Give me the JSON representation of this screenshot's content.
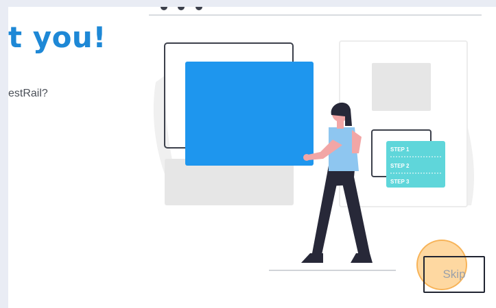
{
  "header": {
    "title": "t you!",
    "question": "estRail?"
  },
  "illustration": {
    "step_labels": [
      "STEP 1",
      "STEP 2",
      "STEP 3"
    ],
    "colors": {
      "accent_blue": "#1e96ee",
      "teal_card": "#5fd6da",
      "shirt": "#8ec6f0",
      "pants": "#272838",
      "skin": "#f2a6a6",
      "hair": "#272838"
    }
  },
  "actions": {
    "skip_label": "Skip"
  },
  "colors": {
    "title": "#1e88d6",
    "highlight": "#fdc36e"
  }
}
